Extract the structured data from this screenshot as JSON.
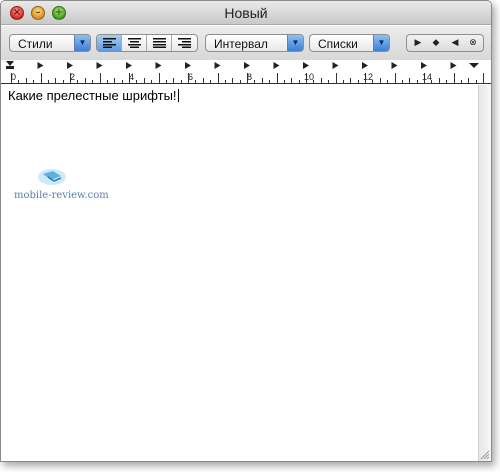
{
  "window": {
    "title": "Новый"
  },
  "toolbar": {
    "styles_label": "Стили",
    "spacing_label": "Интервал",
    "lists_label": "Списки",
    "alignment": {
      "selected": "left",
      "options": [
        "left",
        "center",
        "justify",
        "right"
      ]
    }
  },
  "ruler": {
    "labels": [
      "0",
      "2",
      "4",
      "6",
      "8",
      "10",
      "12",
      "14"
    ]
  },
  "document": {
    "text": "Какие прелестные шрифты!"
  },
  "watermark": {
    "text": "mobile-review.com"
  },
  "colors": {
    "accent": "#3b7fd6",
    "close": "#d32a1b",
    "minimize": "#d9901a",
    "zoom": "#3e9f1a"
  }
}
